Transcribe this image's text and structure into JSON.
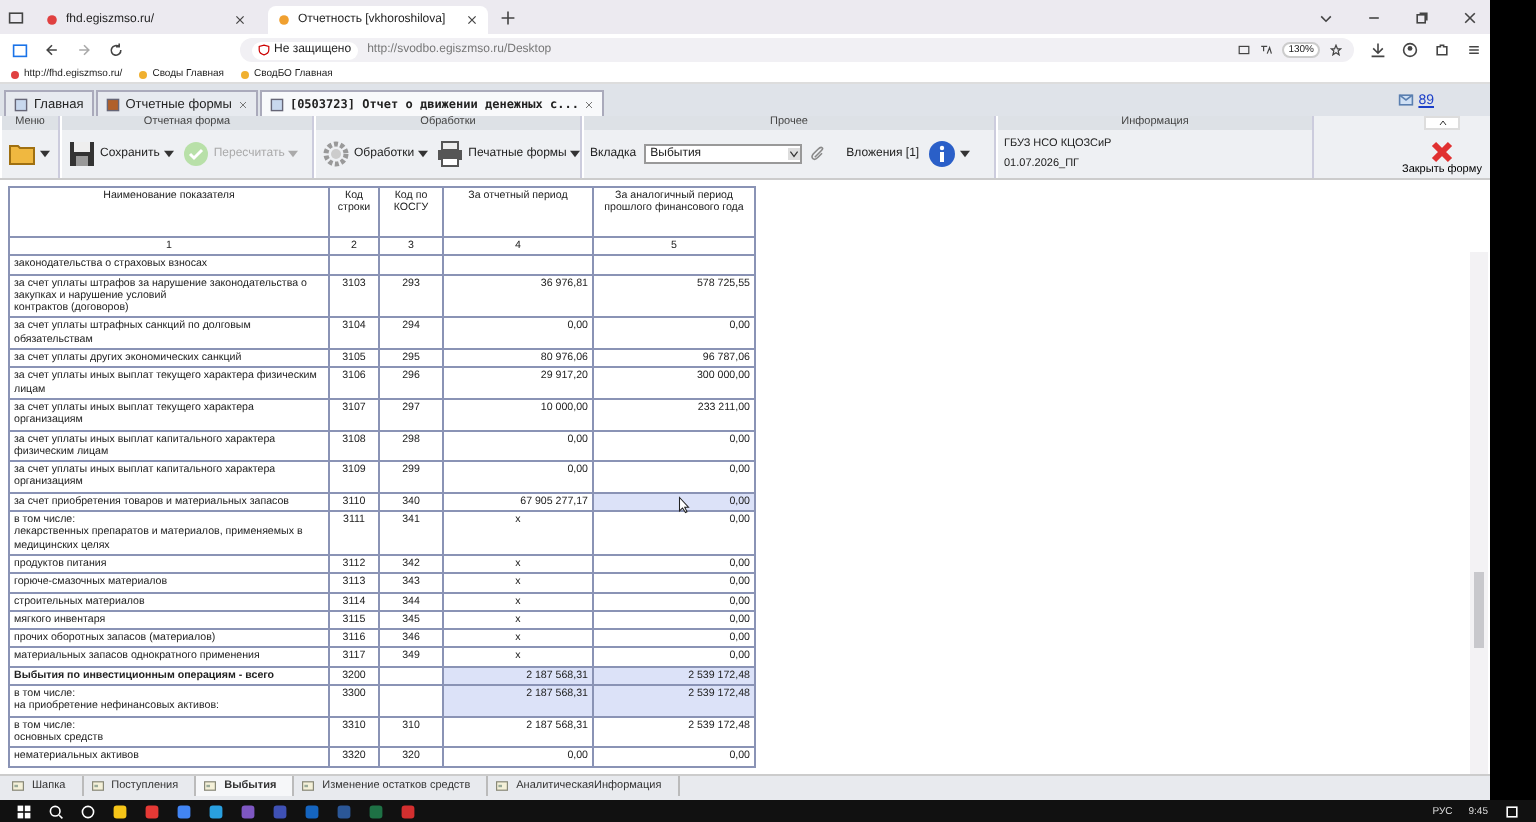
{
  "browser": {
    "tabs": [
      {
        "title": "fhd.egiszmso.ru/",
        "selected": false
      },
      {
        "title": "Отчетность [vkhoroshilova]",
        "selected": true
      }
    ],
    "security": "Не защищено",
    "url": "http://svodbo.egiszmso.ru/Desktop",
    "zoom": "130%",
    "bookmarks": [
      "http://fhd.egiszmso.ru/",
      "Своды Главная",
      "СводБО Главная"
    ]
  },
  "app_tabs": [
    {
      "label": "Главная",
      "closable": false,
      "selected": false
    },
    {
      "label": "Отчетные формы",
      "closable": true,
      "selected": false
    },
    {
      "label": "[0503723] Отчет о движении денежных с...",
      "closable": true,
      "selected": true
    }
  ],
  "messages": {
    "count": "89"
  },
  "toolbar": {
    "groups": [
      {
        "title": "Меню",
        "items": [
          {
            "kind": "folder"
          }
        ]
      },
      {
        "title": "Отчетная форма",
        "items": [
          {
            "kind": "save",
            "label": "Сохранить",
            "disabled": false
          },
          {
            "kind": "recalc",
            "label": "Пересчитать",
            "disabled": true
          }
        ]
      },
      {
        "title": "Обработки",
        "items": [
          {
            "kind": "process",
            "label": "Обработки",
            "disabled": false
          },
          {
            "kind": "print",
            "label": "Печатные формы",
            "disabled": false
          }
        ]
      },
      {
        "title": "Прочее",
        "items": [
          {
            "kind": "tab_select",
            "label": "Вкладка",
            "value": "Выбытия"
          },
          {
            "kind": "attachments",
            "label": "Вложения [1]"
          },
          {
            "kind": "info"
          }
        ]
      },
      {
        "title": "Информация",
        "items": [
          {
            "kind": "org_info",
            "lines": [
              "ГБУЗ НСО КЦОЗСиР",
              "01.07.2026_ПГ"
            ]
          }
        ]
      }
    ]
  },
  "close_form": {
    "label": "Закрыть форму"
  },
  "table": {
    "columns": [
      "Наименование показателя",
      "Код строки",
      "Код по КОСГУ",
      "За отчетный период",
      "За аналогичный период прошлого финансового года"
    ],
    "column_numbers": [
      "1",
      "2",
      "3",
      "4",
      "5"
    ],
    "rows": [
      {
        "name": "законодательства о страховых взносах",
        "code": "",
        "kosgu": "",
        "period": "",
        "prior": "",
        "bold": false,
        "period_shaded": false,
        "prior_shaded": false
      },
      {
        "name": "за счет уплаты штрафов за нарушение законодательства о\nзакупках и нарушение условий\nконтрактов (договоров)",
        "code": "3103",
        "kosgu": "293",
        "period": "36 976,81",
        "prior": "578 725,55",
        "bold": false,
        "period_shaded": false,
        "prior_shaded": false
      },
      {
        "name": "за счет уплаты штрафных санкций по долговым\nобязательствам",
        "code": "3104",
        "kosgu": "294",
        "period": "0,00",
        "prior": "0,00",
        "bold": false,
        "period_shaded": false,
        "prior_shaded": false
      },
      {
        "name": "за счет уплаты других экономических санкций",
        "code": "3105",
        "kosgu": "295",
        "period": "80 976,06",
        "prior": "96 787,06",
        "bold": false,
        "period_shaded": false,
        "prior_shaded": false
      },
      {
        "name": "за счет уплаты иных выплат текущего характера физическим\nлицам",
        "code": "3106",
        "kosgu": "296",
        "period": "29 917,20",
        "prior": "300 000,00",
        "bold": false,
        "period_shaded": false,
        "prior_shaded": false
      },
      {
        "name": "за счет уплаты иных выплат текущего характера организациям",
        "code": "3107",
        "kosgu": "297",
        "period": "10 000,00",
        "prior": "233 211,00",
        "bold": false,
        "period_shaded": false,
        "prior_shaded": false
      },
      {
        "name": "за счет уплаты иных выплат капитального характера\nфизическим лицам",
        "code": "3108",
        "kosgu": "298",
        "period": "0,00",
        "prior": "0,00",
        "bold": false,
        "period_shaded": false,
        "prior_shaded": false
      },
      {
        "name": "за счет уплаты иных выплат капитального характера\nорганизациям",
        "code": "3109",
        "kosgu": "299",
        "period": "0,00",
        "prior": "0,00",
        "bold": false,
        "period_shaded": false,
        "prior_shaded": false
      },
      {
        "name": "за счет приобретения товаров и материальных запасов",
        "code": "3110",
        "kosgu": "340",
        "period": "67 905 277,17",
        "prior": "0,00",
        "bold": false,
        "period_shaded": false,
        "prior_shaded": true
      },
      {
        "name": "в том числе:\nлекарственных препаратов и материалов, применяемых в\nмедицинских целях",
        "code": "3111",
        "kosgu": "341",
        "period": "x",
        "prior": "0,00",
        "bold": false,
        "period_shaded": false,
        "prior_shaded": false
      },
      {
        "name": "продуктов питания",
        "code": "3112",
        "kosgu": "342",
        "period": "x",
        "prior": "0,00",
        "bold": false,
        "period_shaded": false,
        "prior_shaded": false
      },
      {
        "name": "горюче-смазочных материалов",
        "code": "3113",
        "kosgu": "343",
        "period": "x",
        "prior": "0,00",
        "bold": false,
        "period_shaded": false,
        "prior_shaded": false
      },
      {
        "name": "строительных материалов",
        "code": "3114",
        "kosgu": "344",
        "period": "x",
        "prior": "0,00",
        "bold": false,
        "period_shaded": false,
        "prior_shaded": false
      },
      {
        "name": "мягкого инвентаря",
        "code": "3115",
        "kosgu": "345",
        "period": "x",
        "prior": "0,00",
        "bold": false,
        "period_shaded": false,
        "prior_shaded": false
      },
      {
        "name": "прочих оборотных запасов (материалов)",
        "code": "3116",
        "kosgu": "346",
        "period": "x",
        "prior": "0,00",
        "bold": false,
        "period_shaded": false,
        "prior_shaded": false
      },
      {
        "name": "материальных запасов однократного применения",
        "code": "3117",
        "kosgu": "349",
        "period": "x",
        "prior": "0,00",
        "bold": false,
        "period_shaded": false,
        "prior_shaded": false
      },
      {
        "name": "Выбытия по инвестиционным операциям - всего",
        "code": "3200",
        "kosgu": "",
        "period": "2 187 568,31",
        "prior": "2 539 172,48",
        "bold": true,
        "period_shaded": true,
        "prior_shaded": true
      },
      {
        "name": "в том числе:\nна приобретение нефинансовых активов:",
        "code": "3300",
        "kosgu": "",
        "period": "2 187 568,31",
        "prior": "2 539 172,48",
        "bold": false,
        "period_shaded": true,
        "prior_shaded": true
      },
      {
        "name": "в том числе:\nосновных средств",
        "code": "3310",
        "kosgu": "310",
        "period": "2 187 568,31",
        "prior": "2 539 172,48",
        "bold": false,
        "period_shaded": false,
        "prior_shaded": false
      },
      {
        "name": "нематериальных активов",
        "code": "3320",
        "kosgu": "320",
        "period": "0,00",
        "prior": "0,00",
        "bold": false,
        "period_shaded": false,
        "prior_shaded": false
      }
    ]
  },
  "sheet_tabs": [
    {
      "label": "Шапка",
      "selected": false
    },
    {
      "label": "Поступления",
      "selected": false
    },
    {
      "label": "Выбытия",
      "selected": true
    },
    {
      "label": "Изменение остатков средств",
      "selected": false
    },
    {
      "label": "АналитическаяИнформация",
      "selected": false
    }
  ],
  "taskbar": {
    "language": "РУС",
    "time": "9:45"
  }
}
